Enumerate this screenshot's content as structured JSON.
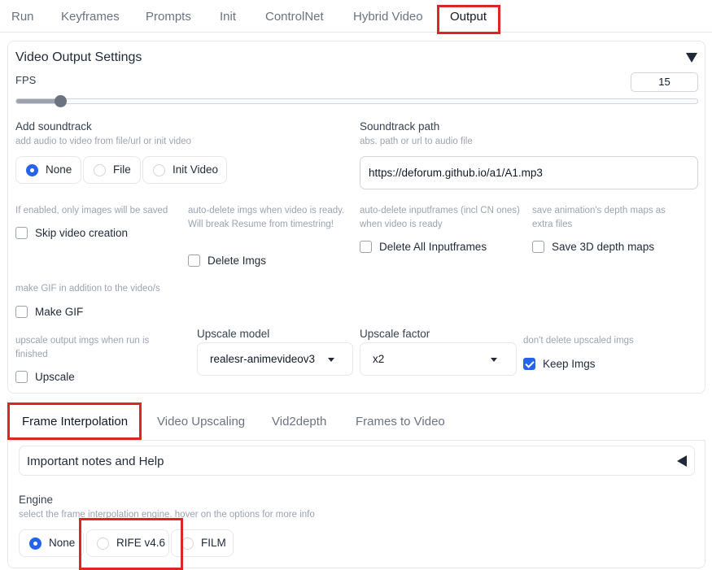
{
  "tabs": [
    "Run",
    "Keyframes",
    "Prompts",
    "Init",
    "ControlNet",
    "Hybrid Video",
    "Output"
  ],
  "active_tab": "Output",
  "video_output": {
    "title": "Video Output Settings",
    "fps_label": "FPS",
    "fps_value": "15",
    "fps_slider_fraction": 0.065,
    "add_soundtrack": {
      "label": "Add soundtrack",
      "description": "add audio to video from file/url or init video",
      "options": [
        "None",
        "File",
        "Init Video"
      ],
      "selected": "None"
    },
    "soundtrack_path": {
      "label": "Soundtrack path",
      "description": "abs. path or url to audio file",
      "value": "https://deforum.github.io/a1/A1.mp3"
    },
    "skip_video": {
      "description": "If enabled, only images will be saved",
      "label": "Skip video creation",
      "checked": false
    },
    "delete_imgs": {
      "description": "auto-delete imgs when video is ready. Will break Resume from timestring!",
      "label": "Delete Imgs",
      "checked": false
    },
    "delete_inputframes": {
      "description": "auto-delete inputframes (incl CN ones) when video is ready",
      "label": "Delete All Inputframes",
      "checked": false
    },
    "save_depth": {
      "description": "save animation's depth maps as extra files",
      "label": "Save 3D depth maps",
      "checked": false
    },
    "make_gif": {
      "description": "make GIF in addition to the video/s",
      "label": "Make GIF",
      "checked": false
    },
    "upscale": {
      "description": "upscale output imgs when run is finished",
      "label": "Upscale",
      "checked": false
    },
    "upscale_model": {
      "label": "Upscale model",
      "value": "realesr-animevideov3"
    },
    "upscale_factor": {
      "label": "Upscale factor",
      "value": "x2"
    },
    "keep_imgs": {
      "description": "don't delete upscaled imgs",
      "label": "Keep Imgs",
      "checked": true
    }
  },
  "sub_tabs": [
    "Frame Interpolation",
    "Video Upscaling",
    "Vid2depth",
    "Frames to Video"
  ],
  "active_sub_tab": "Frame Interpolation",
  "frame_interpolation": {
    "notes_title": "Important notes and Help",
    "engine_label": "Engine",
    "engine_description": "select the frame interpolation engine. hover on the options for more info",
    "engine_options": [
      "None",
      "RIFE v4.6",
      "FILM"
    ],
    "engine_selected": "None"
  },
  "colors": {
    "accent": "#2563eb",
    "highlight": "#dc2626"
  }
}
